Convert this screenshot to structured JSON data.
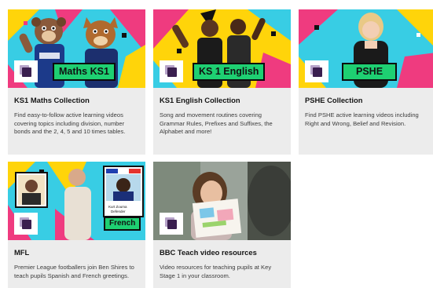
{
  "cards": [
    {
      "title": "KS1 Maths Collection",
      "tag": "Maths KS1",
      "description": "Find easy-to-follow active learning videos covering topics including division, number bonds and the 2, 4, 5 and 10 times tables."
    },
    {
      "title": "KS1 English Collection",
      "tag": "KS 1 English",
      "description": "Song and movement routines covering Grammar Rules, Prefixes and Suffixes, the Alphabet and more!"
    },
    {
      "title": "PSHE Collection",
      "tag": "PSHE",
      "description": "Find PSHE active learning videos including Right and Wrong, Belief and Revision."
    },
    {
      "title": "MFL",
      "tag": "French",
      "player_name": "Kurt Zouma",
      "player_role": "Defender",
      "description": "Premier League footballers join Ben Shires to teach pupils Spanish and French greetings."
    },
    {
      "title": "BBC Teach video resources",
      "description": "Video resources for teaching pupils at Key Stage 1 in your classroom."
    }
  ],
  "colors": {
    "card_bg": "#ececec",
    "tag_green": "#1ed072",
    "icon_purple": "#3a1f4f",
    "banner_cyan": "#38cde4",
    "banner_yellow": "#ffd40a",
    "banner_pink": "#ef3b7f"
  }
}
